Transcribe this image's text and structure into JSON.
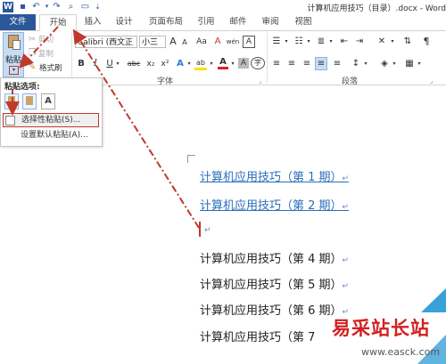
{
  "title_bar": {
    "document_title": "计算机应用技巧（目录）.docx - Word",
    "qat_icons": [
      "word-logo-icon",
      "save-icon",
      "undo-icon",
      "redo-icon",
      "print-preview-icon",
      "open-icon",
      "customize-qat-icon"
    ]
  },
  "tabs": [
    {
      "label": "文件"
    },
    {
      "label": "开始"
    },
    {
      "label": "插入"
    },
    {
      "label": "设计"
    },
    {
      "label": "页面布局"
    },
    {
      "label": "引用"
    },
    {
      "label": "邮件"
    },
    {
      "label": "审阅"
    },
    {
      "label": "视图"
    }
  ],
  "clipboard": {
    "paste_label": "粘贴",
    "cut_label": "剪切",
    "copy_label": "复制",
    "format_painter_label": "格式刷"
  },
  "font_group": {
    "font_name": "Calibri (西文正",
    "font_size": "小三",
    "group_label": "字体",
    "bold": "B",
    "italic": "I",
    "underline": "U",
    "strikethrough": "abc",
    "subscript": "x₂",
    "superscript": "x²",
    "font_color": "A",
    "text_effects": "A",
    "highlight": "ab",
    "grow_font": "A",
    "shrink_font": "A",
    "change_case": "Aa",
    "clear_formatting": "A",
    "phonetic": "wén",
    "char_border": "A",
    "char_shading": "A",
    "enclose": "字"
  },
  "paragraph_group": {
    "group_label": "段落"
  },
  "paste_menu": {
    "header": "粘贴选项:",
    "items": [
      {
        "label": "选择性粘贴(S)..."
      },
      {
        "label": "设置默认粘贴(A)..."
      }
    ]
  },
  "document": {
    "lines": [
      {
        "text": "计算机应用技巧（第 1 期）",
        "link": true
      },
      {
        "text": "计算机应用技巧（第 2 期）",
        "link": true
      },
      {
        "text": "计算机应用技巧（第 4 期）",
        "link": false
      },
      {
        "text": "计算机应用技巧（第 5 期）",
        "link": false
      },
      {
        "text": "计算机应用技巧（第 6 期）",
        "link": false
      },
      {
        "text": "计算机应用技巧（第 7",
        "link": false
      }
    ],
    "paragraph_mark": "↵"
  },
  "watermark": {
    "main": "易采站长站",
    "sub": "www.easck.com"
  },
  "colors": {
    "accent": "#2b579a",
    "annotation_red": "#c0392b",
    "link": "#2a6ebb"
  }
}
